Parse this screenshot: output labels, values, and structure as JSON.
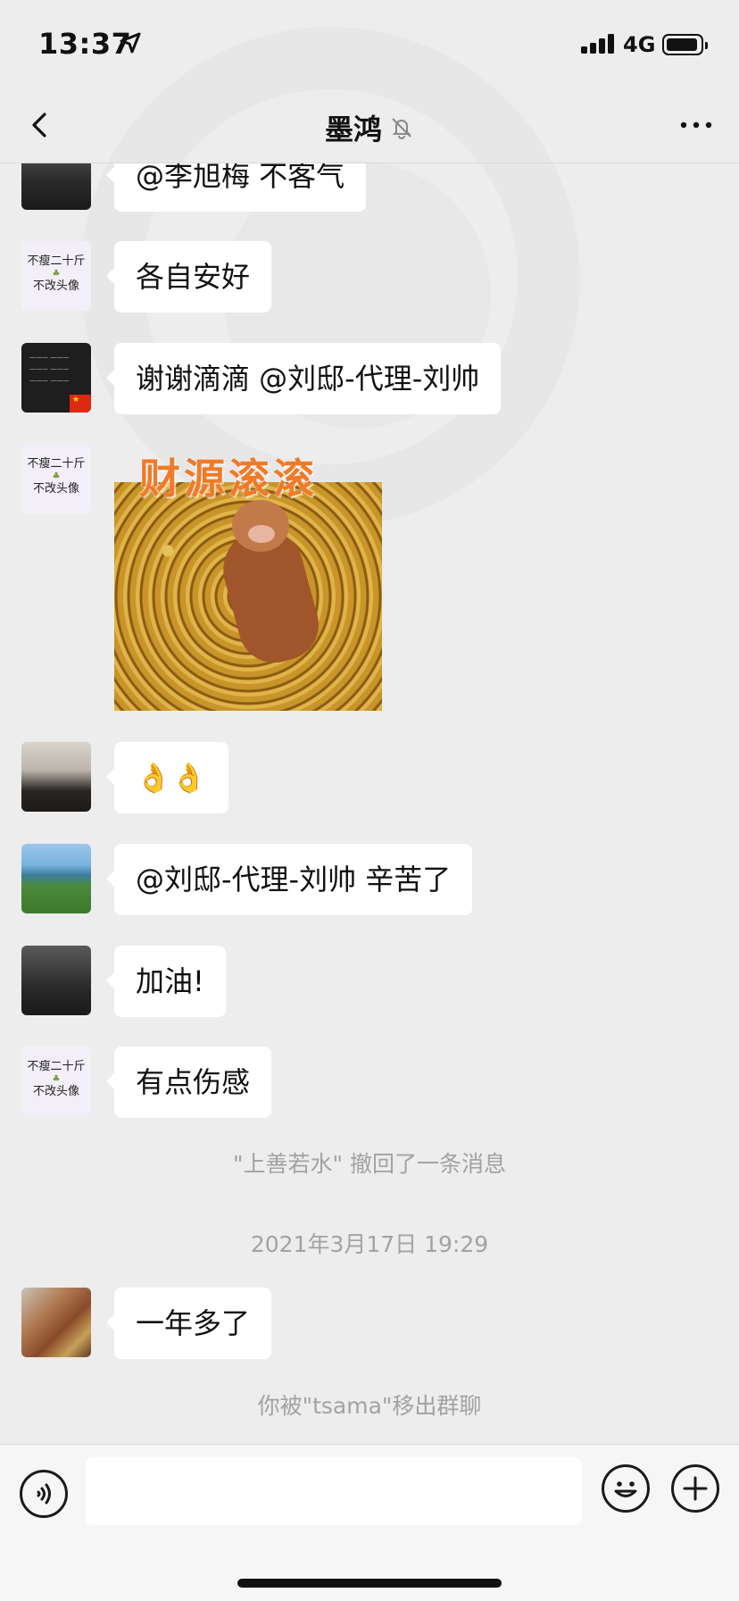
{
  "status_bar": {
    "time": "13:37",
    "network": "4G"
  },
  "nav": {
    "title": "墨鸿"
  },
  "messages": [
    {
      "text": "@李旭梅 不客气"
    },
    {
      "text": "各自安好",
      "avatar_text_line1": "不瘦二十斤",
      "avatar_text_line2": "不改头像"
    },
    {
      "text": "谢谢滴滴 @刘邸-代理-刘帅"
    },
    {
      "sticker_text": "财源滚滚",
      "avatar_text_line1": "不瘦二十斤",
      "avatar_text_line2": "不改头像"
    },
    {
      "text": "👌👌"
    },
    {
      "text": "@刘邸-代理-刘帅 辛苦了"
    },
    {
      "text": "加油!"
    },
    {
      "text": "有点伤感",
      "avatar_text_line1": "不瘦二十斤",
      "avatar_text_line2": "不改头像"
    },
    {
      "text": "一年多了"
    }
  ],
  "system": {
    "recall": "\"上善若水\" 撤回了一条消息",
    "timestamp": "2021年3月17日 19:29",
    "removed": "你被\"tsama\"移出群聊"
  },
  "icons": {
    "back": "chevron-left-icon",
    "mute": "bell-off-icon",
    "more": "more-icon",
    "voice": "voice-icon",
    "emoji": "emoji-icon",
    "plus": "plus-icon"
  }
}
